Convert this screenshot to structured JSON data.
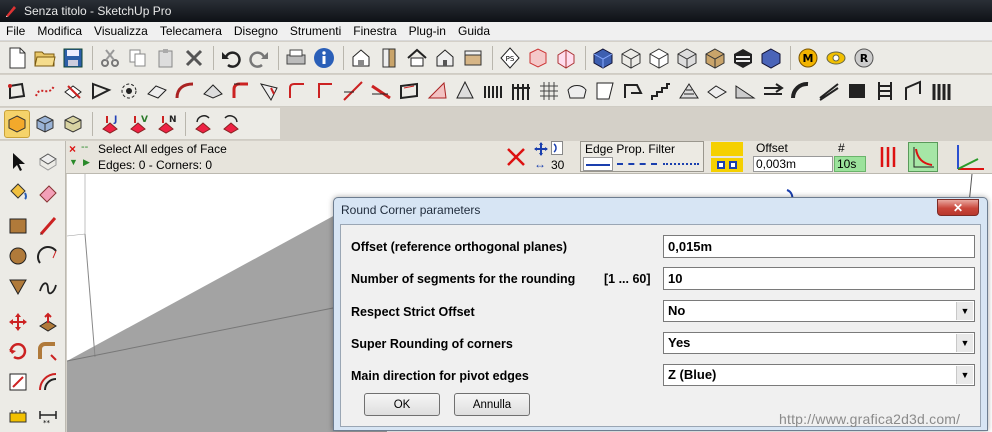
{
  "window": {
    "title": "Senza titolo - SketchUp Pro",
    "accent": "#1a1f26"
  },
  "menu": [
    "File",
    "Modifica",
    "Visualizza",
    "Telecamera",
    "Disegno",
    "Strumenti",
    "Finestra",
    "Plug-in",
    "Guida"
  ],
  "infobar": {
    "line1": "Select All edges of Face",
    "line2": "Edges: 0 - Corners: 0",
    "segments_value": "30",
    "edge_filter_label": "Edge Prop. Filter",
    "offset_label": "Offset",
    "offset_value": "0,003m",
    "count_label": "#",
    "count_value": "10s",
    "count_bg": "#9be29b"
  },
  "dialog": {
    "title": "Round Corner parameters",
    "fields": [
      {
        "label": "Offset (reference orthogonal planes)",
        "value": "0,015m"
      },
      {
        "label": "Number of segments for the rounding",
        "hint": "[1 ... 60]",
        "value": "10"
      },
      {
        "label": "Respect Strict Offset",
        "value": "No"
      },
      {
        "label": "Super Rounding of corners",
        "value": "Yes"
      },
      {
        "label": "Main direction for pivot edges",
        "value": "Z (Blue)"
      }
    ],
    "ok_label": "OK",
    "cancel_label": "Annulla"
  },
  "watermark": "http://www.grafica2d3d.com/"
}
